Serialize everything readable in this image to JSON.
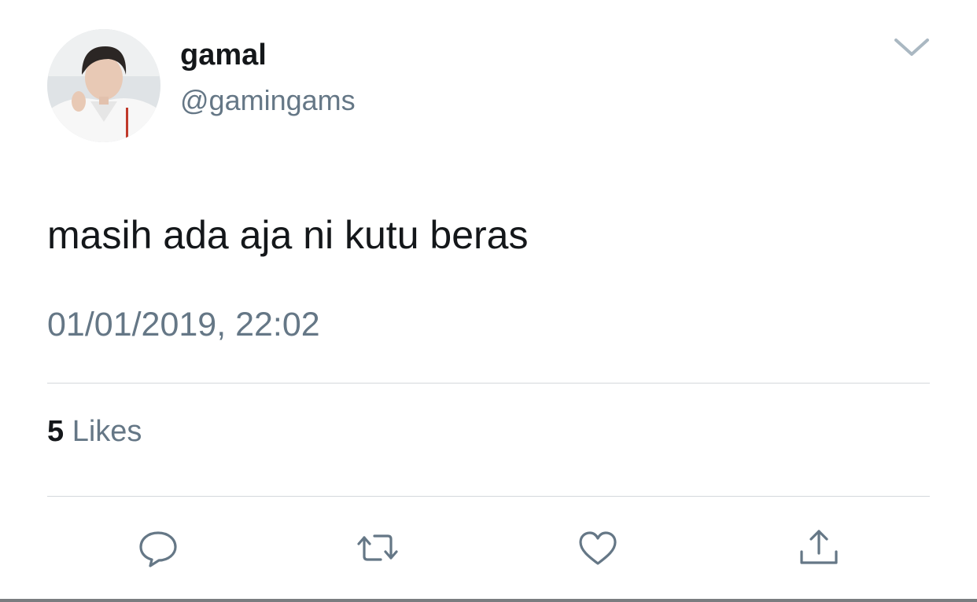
{
  "user": {
    "display_name": "gamal",
    "handle": "@gamingams",
    "avatar_icon": "avatar-photo"
  },
  "tweet": {
    "text": "masih ada aja ni kutu beras",
    "timestamp": "01/01/2019, 22:02"
  },
  "stats": {
    "likes_count": "5",
    "likes_label": "Likes"
  },
  "actions": {
    "reply_icon": "speech-bubble-icon",
    "retweet_icon": "retweet-icon",
    "like_icon": "heart-icon",
    "share_icon": "share-upload-icon"
  },
  "menu": {
    "icon": "chevron-down-icon"
  },
  "colors": {
    "primary_text": "#14171a",
    "secondary_text": "#657786",
    "icon": "#657786",
    "divider": "#d4d8dc",
    "background": "#ffffff"
  }
}
